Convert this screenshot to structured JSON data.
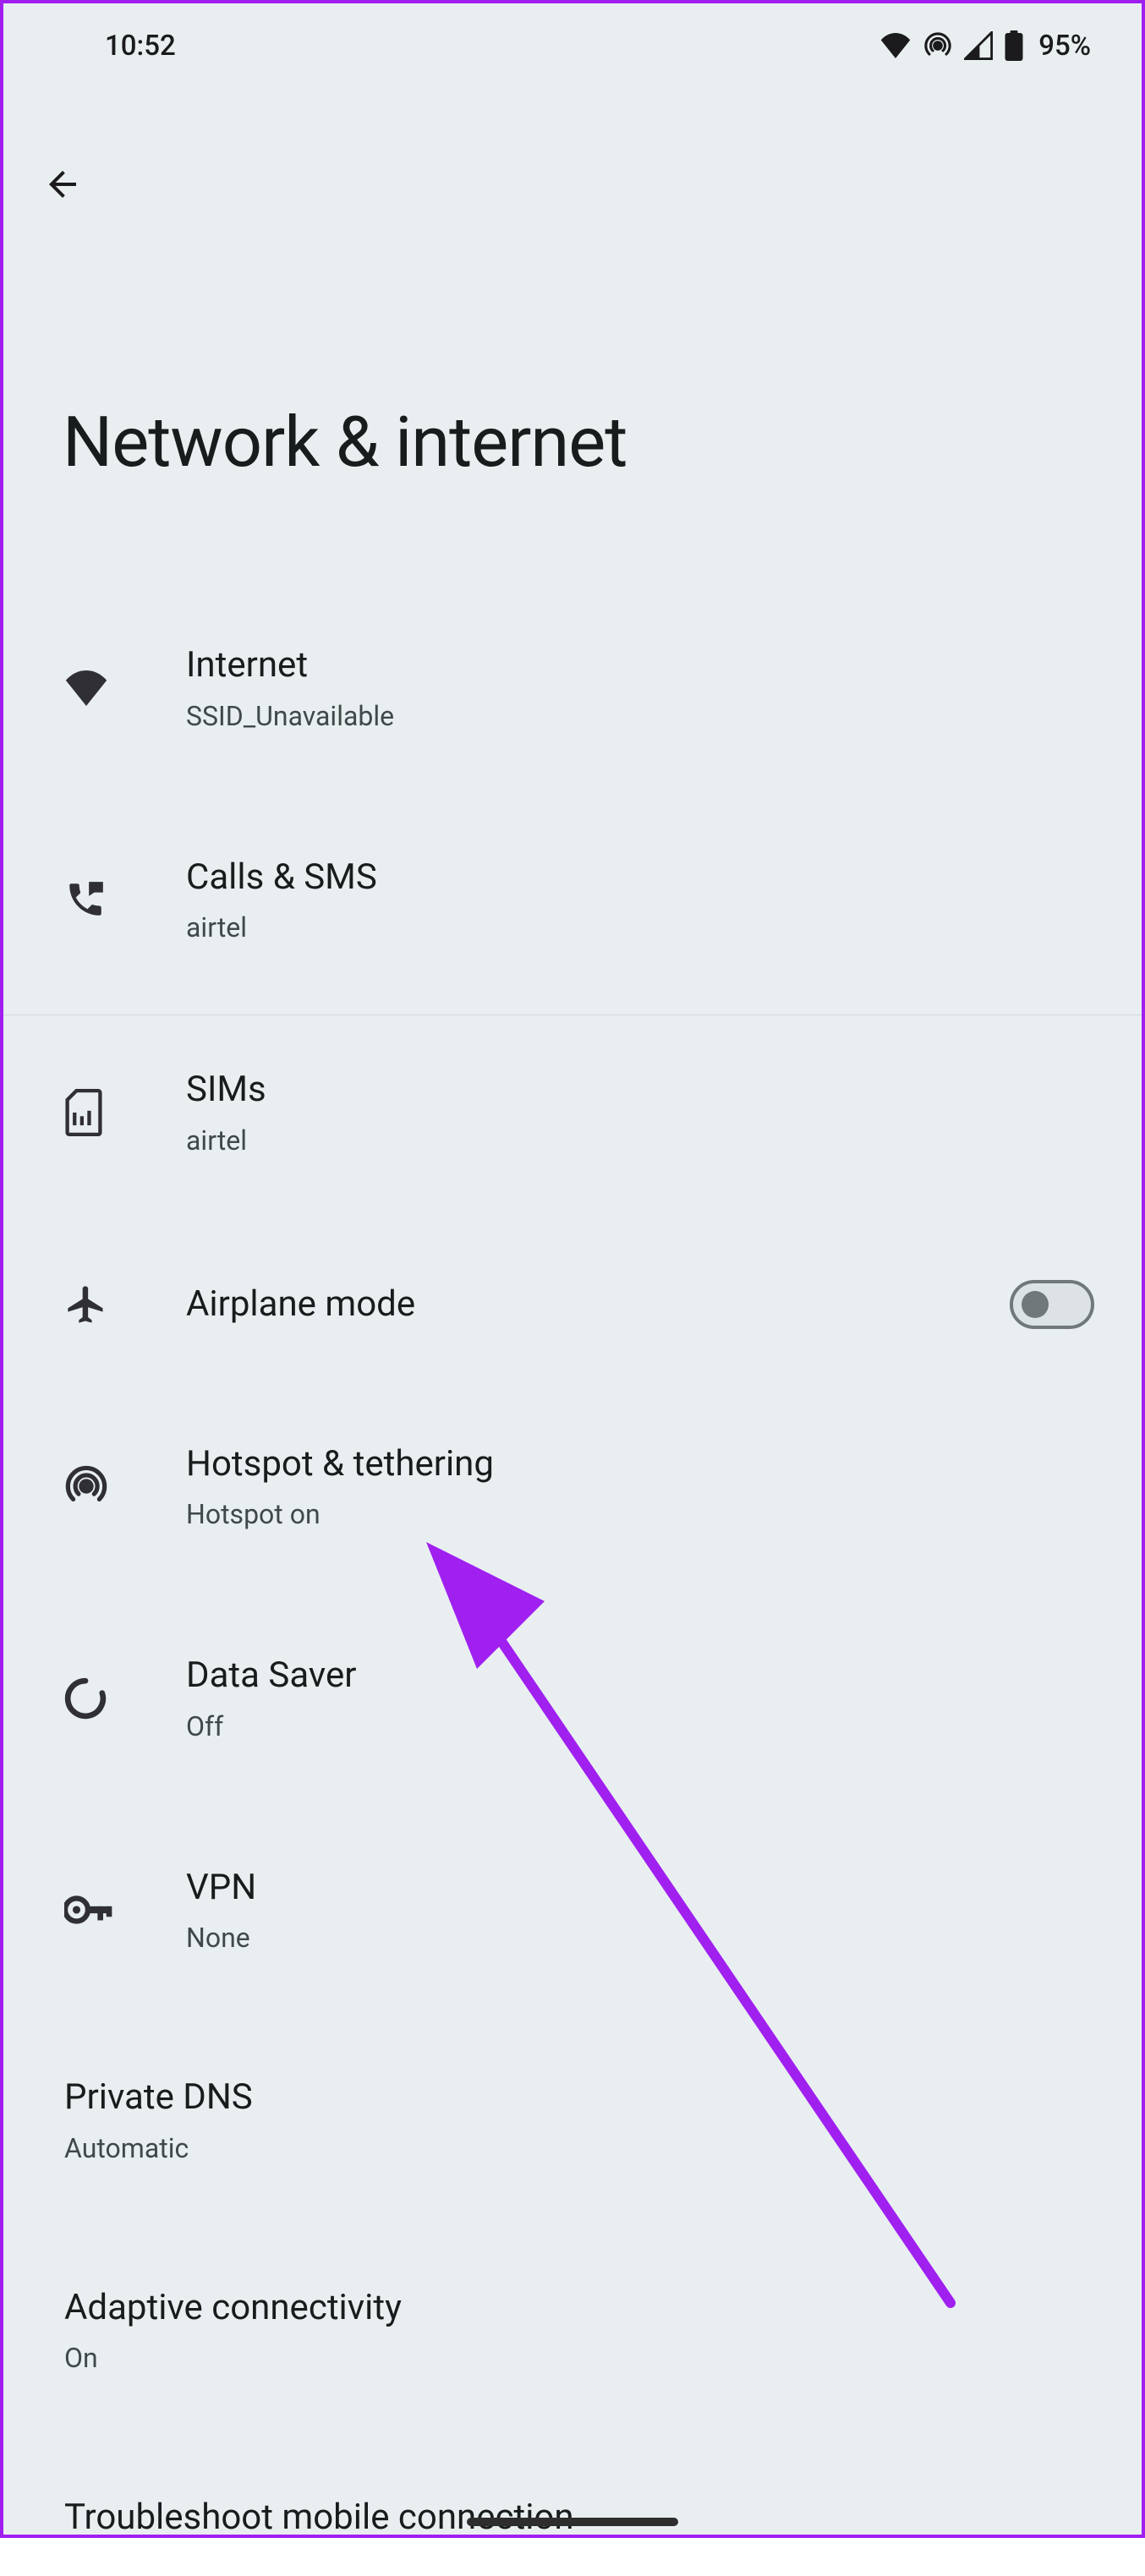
{
  "status": {
    "time": "10:52",
    "battery": "95%"
  },
  "page": {
    "title": "Network & internet"
  },
  "items": [
    {
      "title": "Internet",
      "subtitle": "SSID_Unavailable"
    },
    {
      "title": "Calls & SMS",
      "subtitle": "airtel"
    },
    {
      "title": "SIMs",
      "subtitle": "airtel"
    },
    {
      "title": "Airplane mode"
    },
    {
      "title": "Hotspot & tethering",
      "subtitle": "Hotspot on"
    },
    {
      "title": "Data Saver",
      "subtitle": "Off"
    },
    {
      "title": "VPN",
      "subtitle": "None"
    },
    {
      "title": "Private DNS",
      "subtitle": "Automatic"
    },
    {
      "title": "Adaptive connectivity",
      "subtitle": "On"
    },
    {
      "title": "Troubleshoot mobile connection"
    }
  ]
}
